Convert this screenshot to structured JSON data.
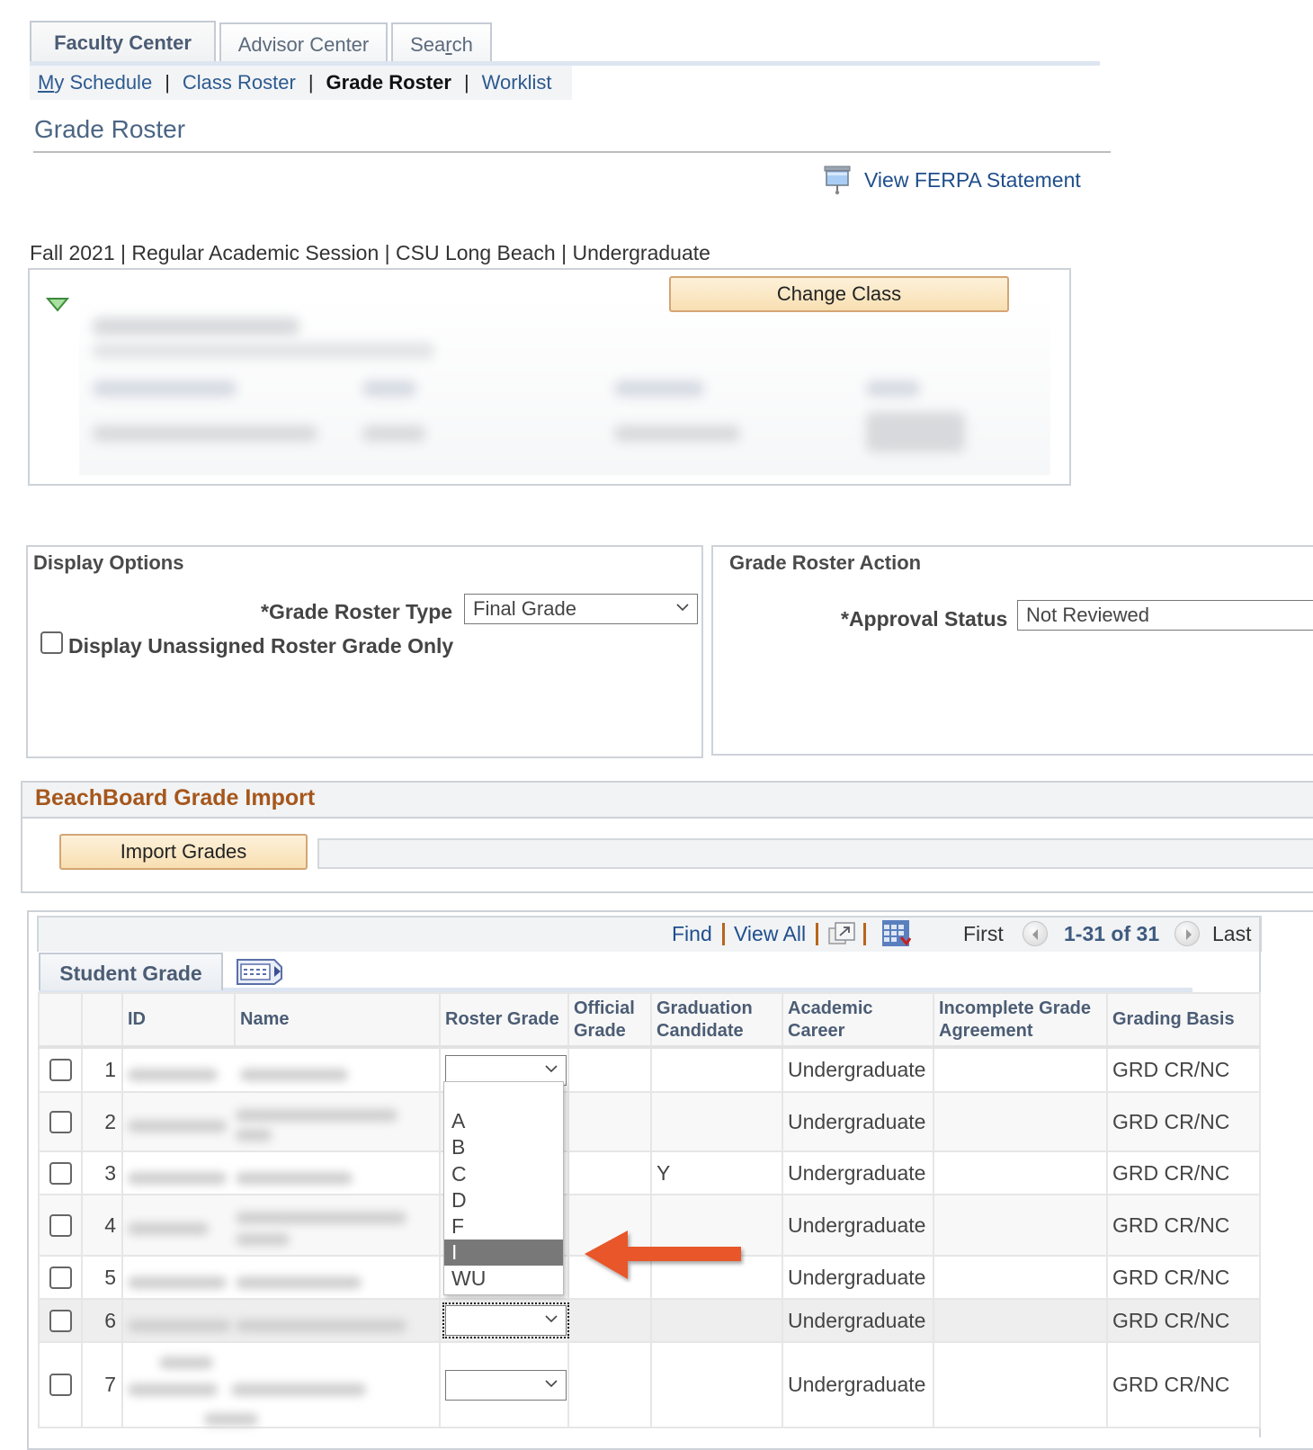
{
  "top_tabs": [
    {
      "label": "Faculty Center",
      "active": true
    },
    {
      "label": "Advisor Center",
      "active": false
    },
    {
      "label": "Search",
      "active": false
    }
  ],
  "subnav": {
    "items": [
      {
        "label": "My Schedule",
        "current": false
      },
      {
        "label": "Class Roster",
        "current": false
      },
      {
        "label": "Grade Roster",
        "current": true
      },
      {
        "label": "Worklist",
        "current": false
      }
    ],
    "separator": "|"
  },
  "page_title": "Grade Roster",
  "ferpa": {
    "label": "View FERPA Statement",
    "icon": "projector-screen-icon"
  },
  "term_line": "Fall 2021 | Regular Academic Session | CSU Long Beach | Undergraduate",
  "class_section": {
    "change_class_label": "Change Class",
    "details": "redacted (blurred)"
  },
  "display_options": {
    "title": "Display Options",
    "roster_type_label": "*Grade Roster Type",
    "roster_type_value": "Final Grade",
    "unassigned_only_label": "Display Unassigned Roster Grade Only",
    "unassigned_only_checked": false
  },
  "grade_roster_action": {
    "title": "Grade Roster Action",
    "approval_status_label": "*Approval Status",
    "approval_status_value": "Not Reviewed"
  },
  "beachboard": {
    "title": "BeachBoard Grade Import",
    "import_button": "Import Grades",
    "status_field": ""
  },
  "grid_toolbar": {
    "find": "Find",
    "view_all": "View All",
    "first": "First",
    "range": "1-31 of 31",
    "last": "Last"
  },
  "grid": {
    "tab_label": "Student Grade",
    "columns": [
      "",
      "",
      "ID",
      "Name",
      "Roster Grade",
      "Official Grade",
      "Graduation Candidate",
      "Academic Career",
      "Incomplete Grade Agreement",
      "Grading Basis"
    ],
    "rows": [
      {
        "n": "1",
        "id": "",
        "name": "",
        "roster_grade": "",
        "official_grade": "",
        "grad_candidate": "",
        "career": "Undergraduate",
        "incomplete": "",
        "basis": "GRD CR/NC"
      },
      {
        "n": "2",
        "id": "",
        "name": "",
        "roster_grade": "",
        "official_grade": "",
        "grad_candidate": "",
        "career": "Undergraduate",
        "incomplete": "",
        "basis": "GRD CR/NC"
      },
      {
        "n": "3",
        "id": "",
        "name": "",
        "roster_grade": "",
        "official_grade": "",
        "grad_candidate": "Y",
        "career": "Undergraduate",
        "incomplete": "",
        "basis": "GRD CR/NC"
      },
      {
        "n": "4",
        "id": "",
        "name": "",
        "roster_grade": "",
        "official_grade": "",
        "grad_candidate": "",
        "career": "Undergraduate",
        "incomplete": "",
        "basis": "GRD CR/NC"
      },
      {
        "n": "5",
        "id": "",
        "name": "",
        "roster_grade": "",
        "official_grade": "",
        "grad_candidate": "",
        "career": "Undergraduate",
        "incomplete": "",
        "basis": "GRD CR/NC"
      },
      {
        "n": "6",
        "id": "",
        "name": "",
        "roster_grade": "",
        "official_grade": "",
        "grad_candidate": "",
        "career": "Undergraduate",
        "incomplete": "",
        "basis": "GRD CR/NC"
      },
      {
        "n": "7",
        "id": "",
        "name": "",
        "roster_grade": "",
        "official_grade": "",
        "grad_candidate": "",
        "career": "Undergraduate",
        "incomplete": "",
        "basis": "GRD CR/NC"
      }
    ]
  },
  "grade_dropdown": {
    "options": [
      "",
      "A",
      "B",
      "C",
      "D",
      "F",
      "I",
      "WU"
    ],
    "highlighted": "I"
  },
  "colors": {
    "link": "#1f4e8c",
    "section_title_brown": "#a6561b",
    "button_tan": "#f8dfb2",
    "annotation_arrow": "#e8562a",
    "dropdown_highlight": "#787878"
  }
}
